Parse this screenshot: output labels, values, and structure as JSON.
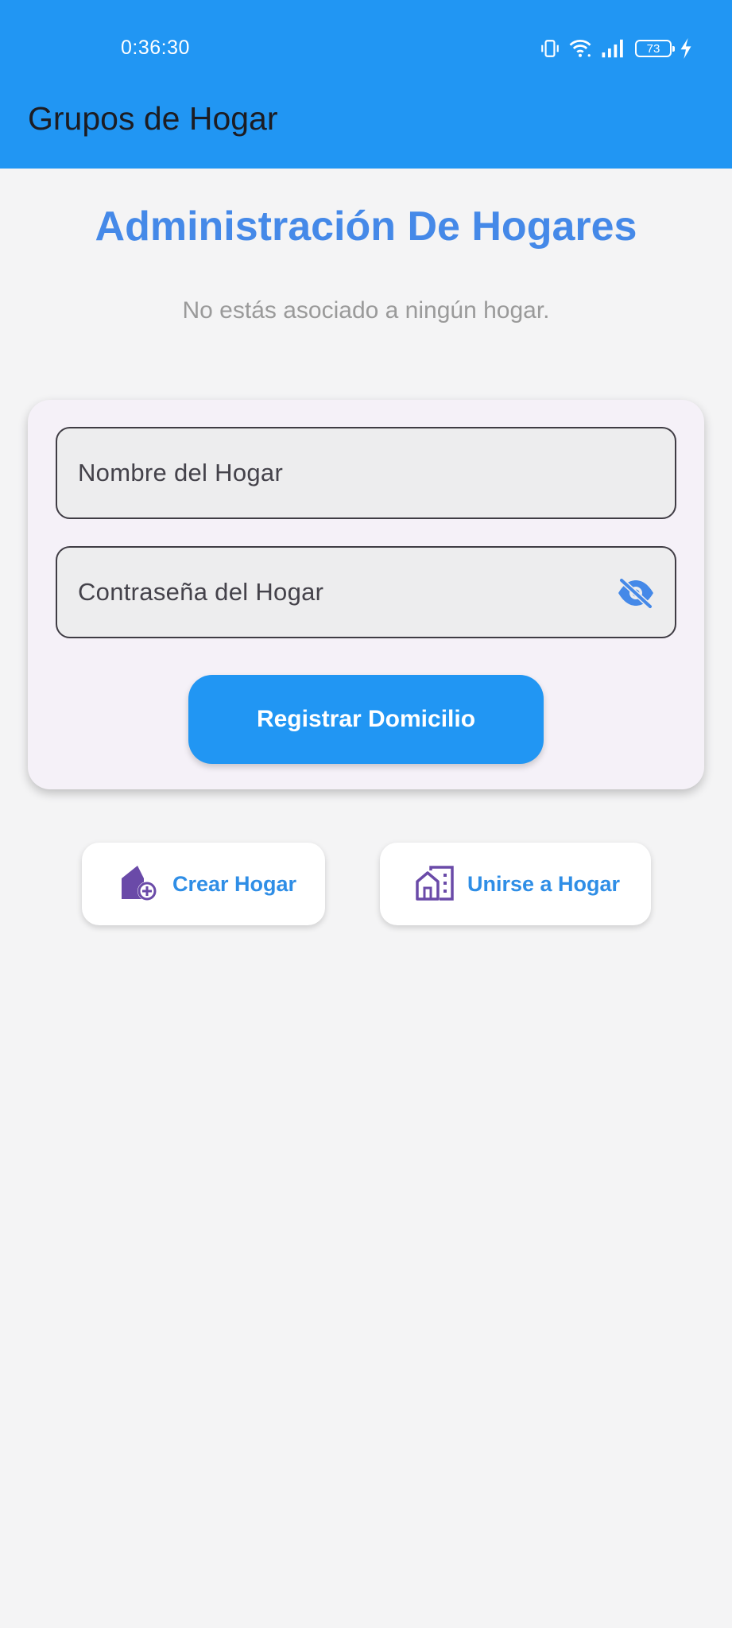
{
  "status_bar": {
    "time": "0:36:30",
    "battery": "73",
    "icons": [
      "vibrate-icon",
      "wifi-icon",
      "signal-icon",
      "battery-icon",
      "charging-icon"
    ]
  },
  "app_bar": {
    "title": "Grupos de Hogar"
  },
  "main": {
    "heading": "Administración De Hogares",
    "subtext": "No estás asociado a ningún hogar."
  },
  "form": {
    "home_name_placeholder": "Nombre del Hogar",
    "home_password_placeholder": "Contraseña del Hogar",
    "visibility_icon": "visibility-off-icon",
    "register_label": "Registrar Domicilio"
  },
  "actions": {
    "create_label": "Crear Hogar",
    "create_icon": "add-home-icon",
    "join_label": "Unirse a Hogar",
    "join_icon": "home-buildings-icon"
  },
  "colors": {
    "app_bar": "#2196f3",
    "heading": "#4589e8",
    "primary_button": "#2196f3",
    "action_label": "#2f8ee6",
    "action_icon": "#6a4aa8",
    "background": "#f4f4f5",
    "card": "#f5f1f8"
  }
}
